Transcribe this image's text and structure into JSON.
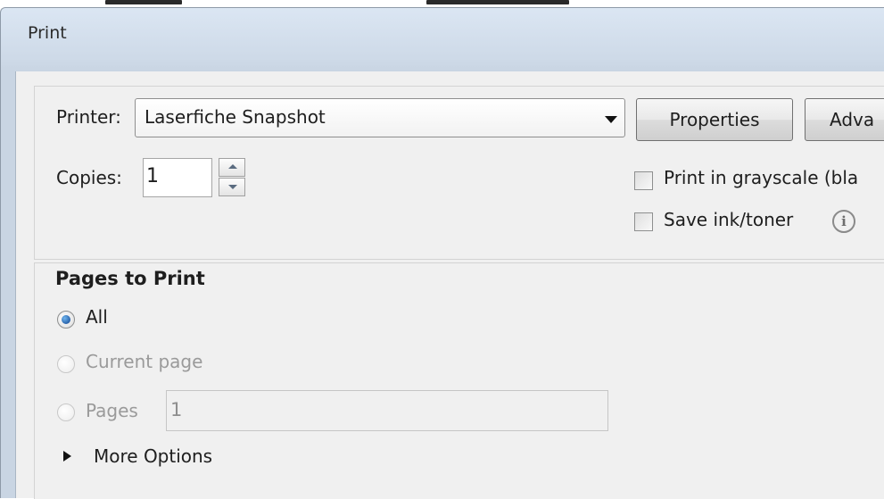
{
  "window": {
    "title": "Print"
  },
  "printer": {
    "label": "Printer:",
    "selected": "Laserfiche Snapshot",
    "properties_label": "Properties",
    "advanced_label": "Adva"
  },
  "copies": {
    "label": "Copies:",
    "value": "1"
  },
  "options": {
    "grayscale_label": "Print in grayscale (bla",
    "grayscale_checked": false,
    "save_ink_label": "Save ink/toner",
    "save_ink_checked": false,
    "info_glyph": "i"
  },
  "pages_to_print": {
    "heading": "Pages to Print",
    "all_label": "All",
    "current_label": "Current page",
    "pages_label": "Pages",
    "pages_value": "1",
    "selected": "All"
  },
  "more_options_label": "More Options",
  "colors": {
    "accent": "#0b3e8c",
    "title_bar": "#cdd9e7",
    "dialog_bg": "#f0f0f0"
  }
}
